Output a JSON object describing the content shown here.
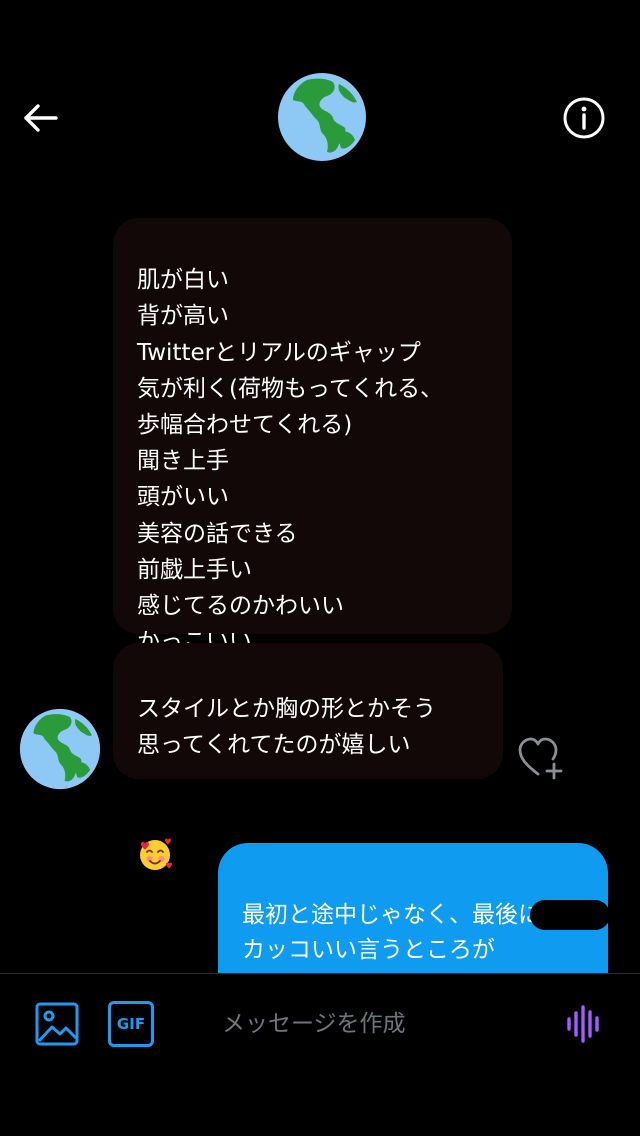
{
  "header": {
    "back_icon": "arrow-left-icon",
    "info_icon": "info-circle-icon",
    "avatar_icon": "globe-americas-emoji"
  },
  "messages": [
    {
      "direction": "incoming",
      "text": "肌が白い\n背が高い\nTwitterとリアルのギャップ\n気が利く(荷物もってくれる、\n歩幅合わせてくれる)\n聞き上手\n頭がいい\n美容の話できる\n前戯上手い\n感じてるのかわいい\nかっこいい"
    },
    {
      "direction": "incoming",
      "text": "スタイルとか胸の形とかそう\n思ってくれてたのが嬉しい",
      "emoji": "smiling-face-with-hearts"
    },
    {
      "direction": "outgoing",
      "text": "最初と途中じゃなく、最後に\nカッコいい言うところが\nらしい"
    }
  ],
  "sender": {
    "avatar_icon": "globe-americas-emoji"
  },
  "reaction": {
    "icon": "heart-plus-icon"
  },
  "composer": {
    "image_icon": "image-icon",
    "gif_label": "GIF",
    "placeholder": "メッセージを作成",
    "voice_icon": "voice-waveform-icon"
  },
  "colors": {
    "background": "#000000",
    "incoming_bubble": "#120808",
    "outgoing_bubble": "#0f9bf0",
    "accent_blue": "#1d9bf0",
    "voice_purple": "#a35cff"
  }
}
